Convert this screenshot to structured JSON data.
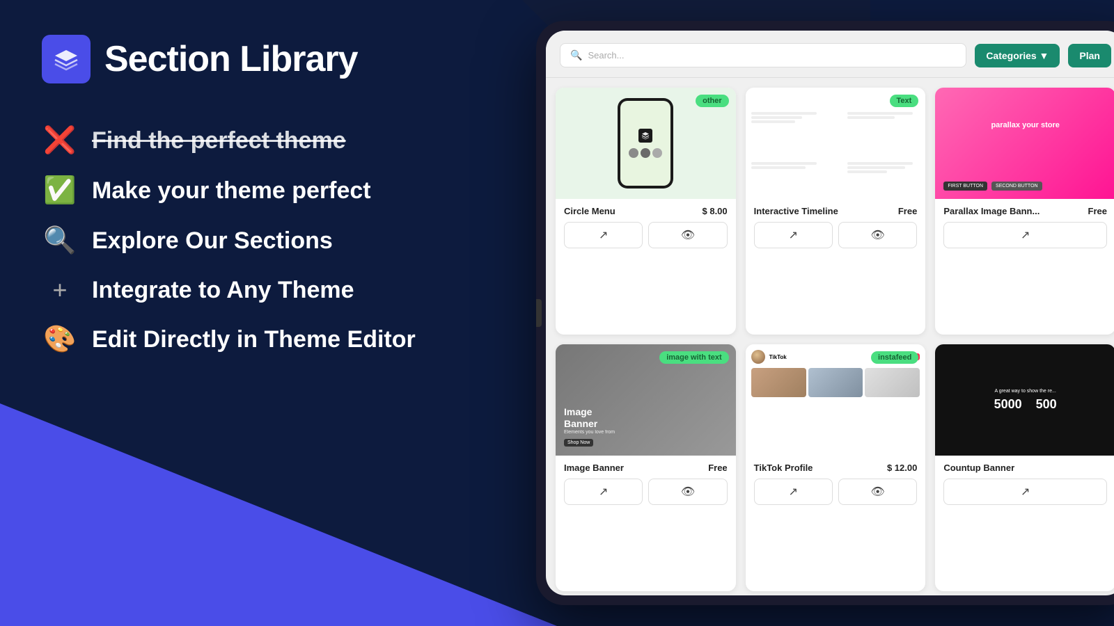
{
  "app": {
    "title": "Section Library"
  },
  "logo": {
    "icon_label": "layers-icon"
  },
  "features": [
    {
      "icon": "❌",
      "text": "Find the perfect theme",
      "strikethrough": true,
      "id": "find-theme"
    },
    {
      "icon": "✅",
      "text": "Make your theme perfect",
      "strikethrough": false,
      "id": "make-perfect"
    },
    {
      "icon": "🔍",
      "text": "Explore Our Sections",
      "strikethrough": false,
      "id": "explore"
    },
    {
      "icon": "➕",
      "text": "Integrate to Any Theme",
      "strikethrough": false,
      "id": "integrate"
    },
    {
      "icon": "🎨",
      "text": "Edit Directly in Theme Editor",
      "strikethrough": false,
      "id": "edit"
    }
  ],
  "header": {
    "search_placeholder": "Search...",
    "categories_label": "Categories ▼",
    "plan_label": "Plan"
  },
  "cards": [
    {
      "id": "circle-menu",
      "name": "Circle Menu",
      "price": "$ 8.00",
      "badge": "other",
      "badge_class": "badge-other",
      "row": 0
    },
    {
      "id": "interactive-timeline",
      "name": "Interactive Timeline",
      "price": "Free",
      "badge": "Text",
      "badge_class": "badge-text",
      "row": 0
    },
    {
      "id": "parallax-image-banner",
      "name": "Parallax Image Bann...",
      "price": "Free",
      "badge": null,
      "badge_class": "",
      "row": 0,
      "partial": true
    },
    {
      "id": "image-banner",
      "name": "Image Banner",
      "price": "Free",
      "badge": "image with text",
      "badge_class": "badge-image-with-text",
      "row": 1
    },
    {
      "id": "tiktok-profile",
      "name": "TikTok Profile",
      "price": "$ 12.00",
      "badge": "instafeed",
      "badge_class": "badge-instafeed",
      "row": 1
    },
    {
      "id": "countup-banner",
      "name": "Countup Banner",
      "price": "",
      "badge": null,
      "badge_class": "",
      "row": 1,
      "partial": true
    }
  ],
  "icons": {
    "external_link": "↗",
    "eye": "👁",
    "search": "🔍",
    "chevron_down": "▼"
  },
  "countup": {
    "title": "A great way to show the re...",
    "number1": "5000",
    "number2": "500"
  }
}
